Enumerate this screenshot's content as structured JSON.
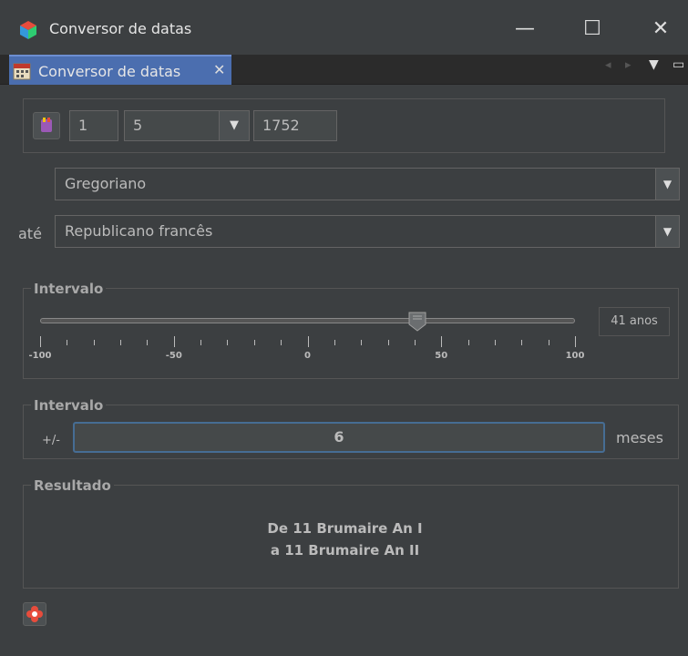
{
  "window": {
    "title": "Conversor de datas",
    "minimize_glyph": "—",
    "maximize_glyph": "☐",
    "close_glyph": "✕"
  },
  "tab": {
    "label": "Conversor de datas",
    "close_glyph": "✕",
    "nav_left_glyph": "◂",
    "nav_right_glyph": "▸",
    "menu_glyph": "▼",
    "restore_glyph": "▭"
  },
  "date": {
    "day": "1",
    "month": "5",
    "year": "1752",
    "arrow_glyph": "▼"
  },
  "from_calendar": {
    "value": "Gregoriano",
    "arrow_glyph": "▼"
  },
  "to_calendar": {
    "label": "até",
    "value": "Republicano francês",
    "arrow_glyph": "▼"
  },
  "interval_years": {
    "title": "Intervalo",
    "slider_value": 41,
    "slider_min": -100,
    "slider_max": 100,
    "tick_labels": [
      "-100",
      "-50",
      "0",
      "50",
      "100"
    ],
    "value_text": "41 anos"
  },
  "interval_months": {
    "title": "Intervalo",
    "prefix": "+/-",
    "value": "6",
    "unit": "meses"
  },
  "result": {
    "title": "Resultado",
    "line1": "De 11 Brumaire An I",
    "line2": "a 11 Brumaire An II"
  },
  "colors": {
    "background": "#3c3f41",
    "tab_active": "#4b6eaf",
    "focus_border": "#466d94"
  }
}
